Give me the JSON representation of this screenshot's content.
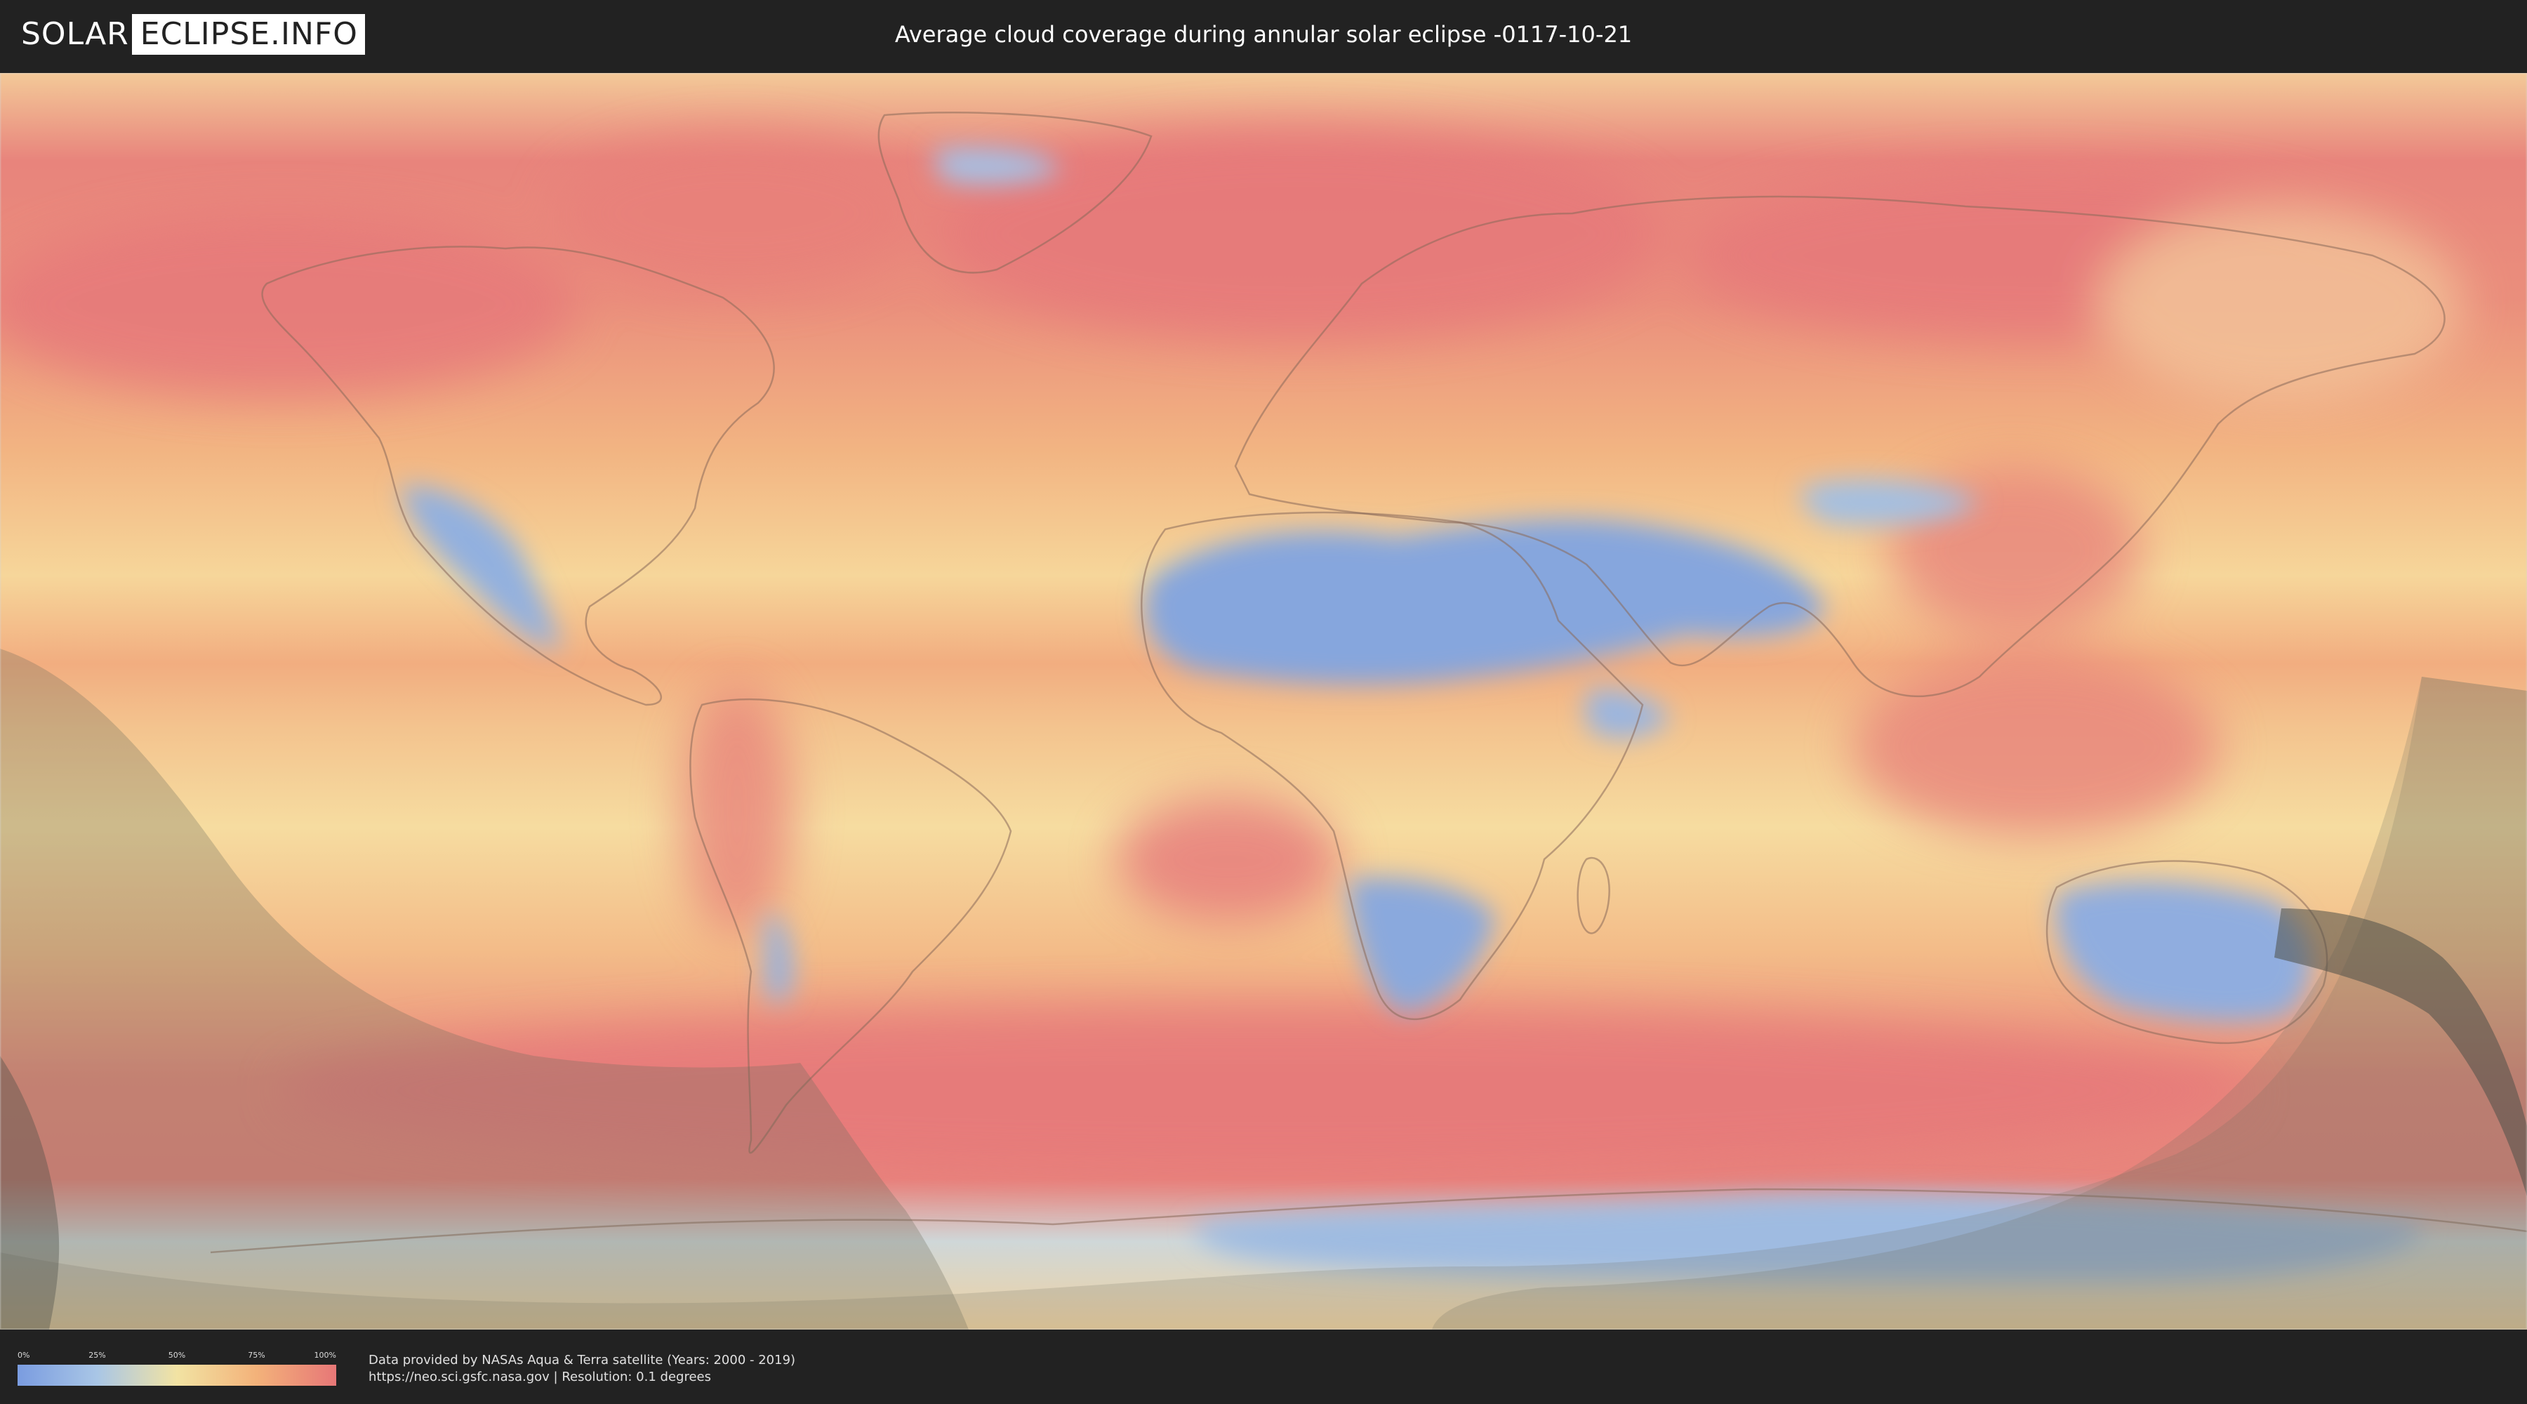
{
  "header": {
    "logo_left": "SOLAR",
    "logo_right": "ECLIPSE.INFO",
    "title": "Average cloud coverage during annular solar eclipse -0117-10-21"
  },
  "legend": {
    "ticks": [
      "0%",
      "25%",
      "50%",
      "75%",
      "100%"
    ],
    "colors": [
      "#7a9ce0",
      "#a9c6e6",
      "#f2e3a3",
      "#f3b27a",
      "#e77777"
    ]
  },
  "credits": {
    "line1": "Data provided by NASAs Aqua & Terra satellite (Years: 2000 - 2019)",
    "line2": "https://neo.sci.gsfc.nasa.gov | Resolution: 0.1 degrees"
  },
  "map": {
    "clear_color": "#86a6dd",
    "mid_color": "#f4dc9a",
    "cloudy_color": "#e6787a",
    "eclipse_shadow_color": "#6e6e5e"
  }
}
